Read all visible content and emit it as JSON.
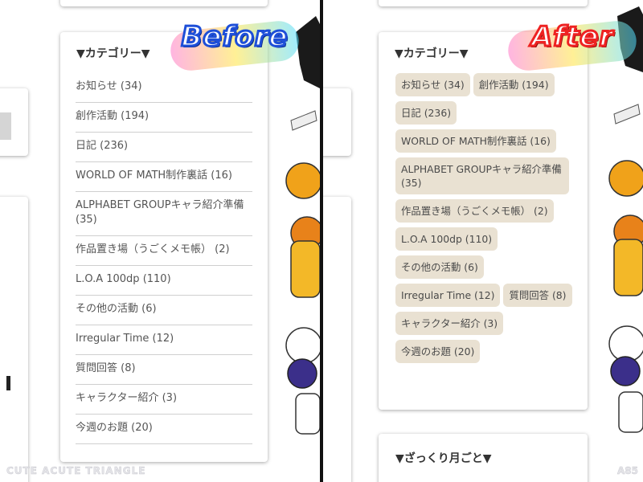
{
  "before": {
    "badge": "Before",
    "title": "▼カテゴリー▼",
    "items": [
      "お知らせ (34)",
      "創作活動 (194)",
      "日記 (236)",
      "WORLD OF MATH制作裏話 (16)",
      "ALPHABET GROUPキャラ紹介準備 (35)",
      "作品置き場（うごくメモ帳） (2)",
      "L.O.A 100dp (110)",
      "その他の活動 (6)",
      "Irregular Time (12)",
      "質問回答 (8)",
      "キャラクター紹介 (3)",
      "今週のお題 (20)"
    ],
    "footer": "CUTE ACUTE TRIANGLE"
  },
  "after": {
    "badge": "After",
    "title": "▼カテゴリー▼",
    "tags": [
      "お知らせ (34)",
      "創作活動 (194)",
      "日記 (236)",
      "WORLD OF MATH制作裏話 (16)",
      "ALPHABET GROUPキャラ紹介準備 (35)",
      "作品置き場（うごくメモ帳） (2)",
      "L.O.A 100dp (110)",
      "その他の活動 (6)",
      "Irregular Time (12)",
      "質問回答 (8)",
      "キャラクター紹介 (3)",
      "今週のお題 (20)"
    ],
    "next_title": "▼ざっくり月ごと▼",
    "corner": "A85"
  },
  "colors": {
    "tag_bg": "#e9e1d2",
    "before_badge": "#1e4fd8",
    "after_badge": "#e22222"
  }
}
